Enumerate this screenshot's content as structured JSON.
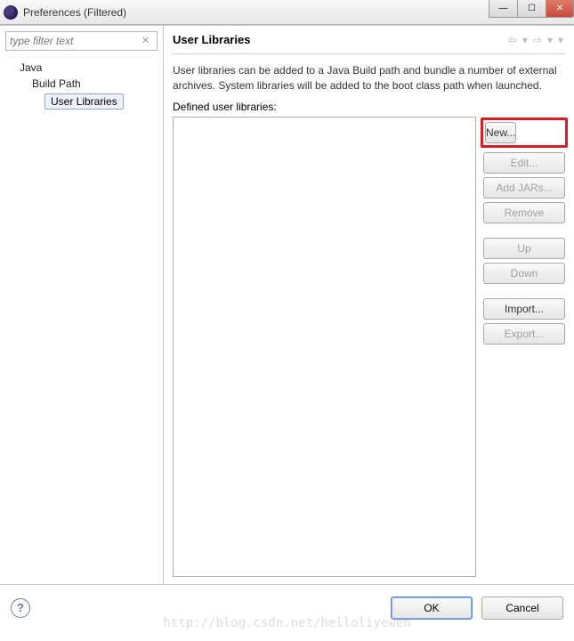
{
  "window": {
    "title": "Preferences (Filtered)"
  },
  "left": {
    "filter_placeholder": "type filter text",
    "tree": {
      "root": "Java",
      "child": "Build Path",
      "leaf": "User Libraries"
    }
  },
  "page": {
    "heading": "User Libraries",
    "description": "User libraries can be added to a Java Build path and bundle a number of external archives. System libraries will be added to the boot class path when launched.",
    "defined_label": "Defined user libraries:"
  },
  "buttons": {
    "new": "New...",
    "edit": "Edit...",
    "addjars": "Add JARs...",
    "remove": "Remove",
    "up": "Up",
    "down": "Down",
    "import": "Import...",
    "export": "Export..."
  },
  "footer": {
    "ok": "OK",
    "cancel": "Cancel"
  },
  "watermark": "http://blog.csdn.net/helloliyewen"
}
